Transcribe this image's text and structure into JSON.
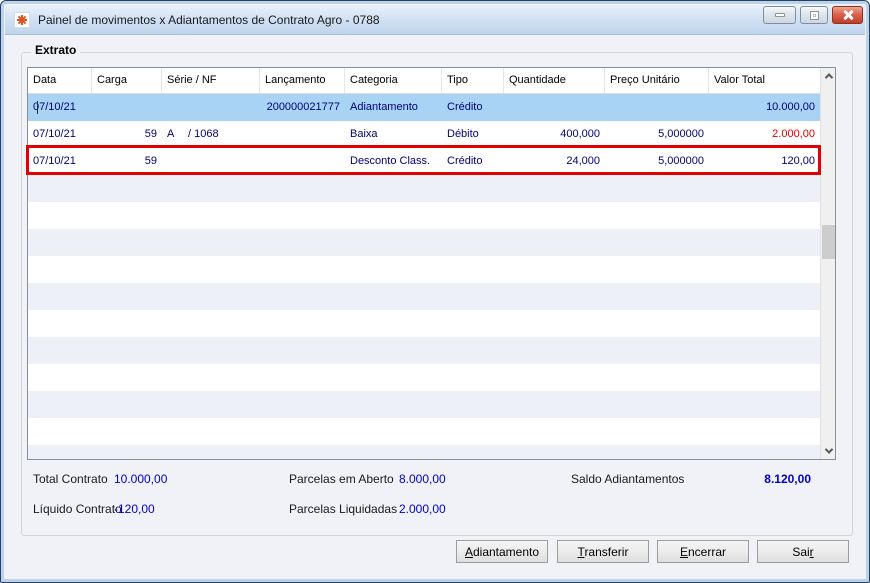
{
  "window": {
    "title": "Painel de movimentos x Adiantamentos de Contrato Agro - 0788"
  },
  "extrato": {
    "label": "Extrato",
    "columns": [
      "Data",
      "Carga",
      "Série / NF",
      "Lançamento",
      "Categoria",
      "Tipo",
      "Quantidade",
      "Preço Unitário",
      "Valor Total"
    ],
    "rows": [
      {
        "data": "07/10/21",
        "carga": "",
        "serie_letter": "",
        "serie_nf": "",
        "lancamento": "200000021777",
        "categoria": "Adiantamento",
        "tipo": "Crédito",
        "quantidade": "",
        "preco_unitario": "",
        "valor_total": "10.000,00"
      },
      {
        "data": "07/10/21",
        "carga": "59",
        "serie_letter": "A",
        "serie_nf": "/ 1068",
        "lancamento": "",
        "categoria": "Baixa",
        "tipo": "Débito",
        "quantidade": "400,000",
        "preco_unitario": "5,000000",
        "valor_total": "2.000,00"
      },
      {
        "data": "07/10/21",
        "carga": "59",
        "serie_letter": "",
        "serie_nf": "",
        "lancamento": "",
        "categoria": "Desconto Class.",
        "tipo": "Crédito",
        "quantidade": "24,000",
        "preco_unitario": "5,000000",
        "valor_total": "120,00"
      }
    ]
  },
  "summary": {
    "total_contrato_label": "Total Contrato",
    "total_contrato_value": "10.000,00",
    "parcelas_aberto_label": "Parcelas em Aberto",
    "parcelas_aberto_value": "8.000,00",
    "saldo_adiantamentos_label": "Saldo Adiantamentos",
    "saldo_adiantamentos_value": "8.120,00",
    "liquido_contrato_label": "Líquido Contrato",
    "liquido_contrato_value": "-120,00",
    "parcelas_liquidadas_label": "Parcelas Liquidadas",
    "parcelas_liquidadas_value": "2.000,00"
  },
  "buttons": {
    "adiantamento": {
      "pre": "",
      "accel": "A",
      "post": "diantamento"
    },
    "transferir": {
      "pre": "",
      "accel": "T",
      "post": "ransferir"
    },
    "encerrar": {
      "pre": "",
      "accel": "E",
      "post": "ncerrar"
    },
    "sair": {
      "pre": "Sai",
      "accel": "r",
      "post": ""
    }
  },
  "colors": {
    "selected_row": "#a9d3f4",
    "stripe": "#eef0f7",
    "data_text": "#00007a",
    "negative_value": "#e10000",
    "summary_value": "#0000cd",
    "annotation_border": "#e30000"
  }
}
